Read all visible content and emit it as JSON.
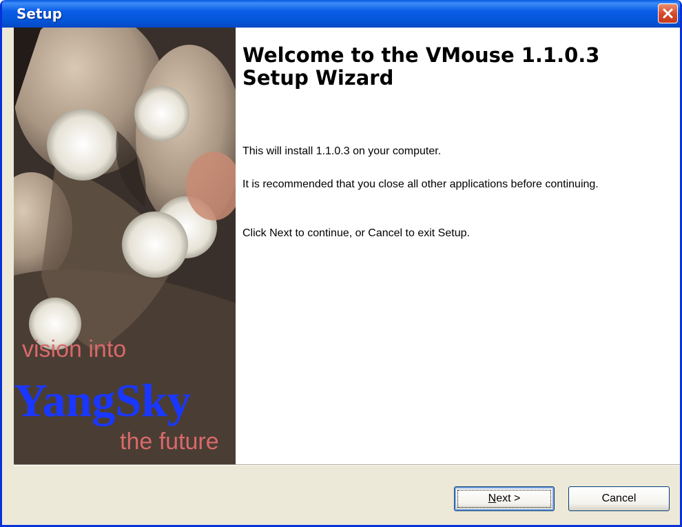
{
  "window": {
    "title": "Setup",
    "title_bar_color": "#0a5de7",
    "close_icon": "close-icon"
  },
  "image": {
    "line1": "vision into",
    "line2": "YangSky",
    "line3": "the future"
  },
  "content": {
    "heading": "Welcome to the VMouse 1.1.0.3 Setup Wizard",
    "para1": "This will install 1.1.0.3 on your computer.",
    "para2": "It is recommended that you close all other applications before continuing.",
    "para3": "Click Next to continue, or Cancel to exit Setup."
  },
  "buttons": {
    "next_accel": "N",
    "next_rest": "ext >",
    "cancel": "Cancel"
  }
}
